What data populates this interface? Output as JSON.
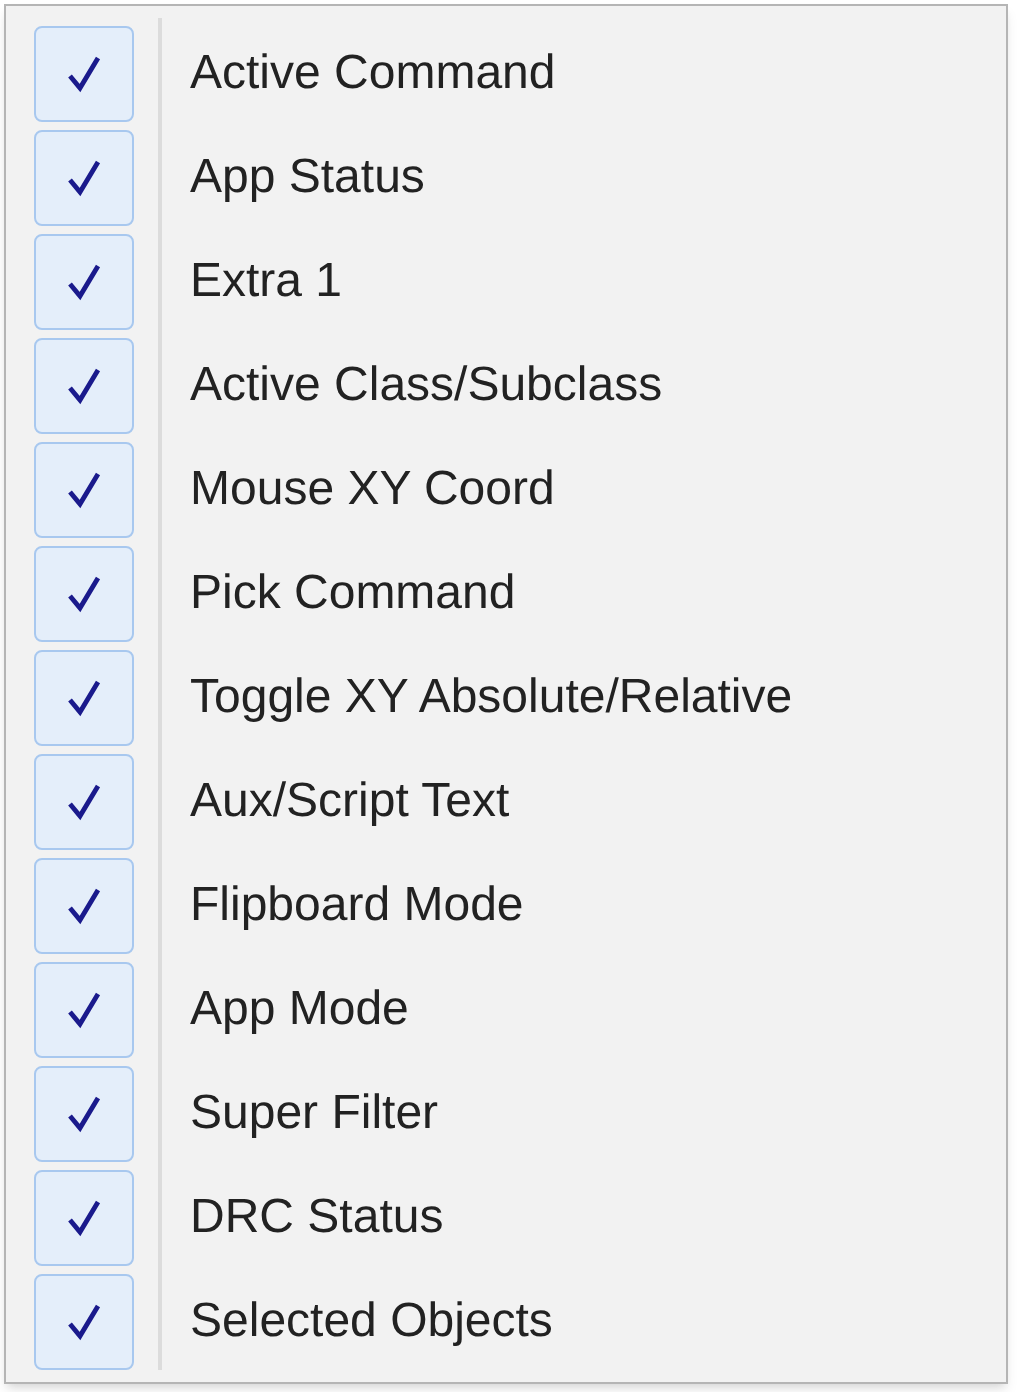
{
  "menu": {
    "items": [
      {
        "label": "Active Command",
        "checked": true
      },
      {
        "label": "App Status",
        "checked": true
      },
      {
        "label": "Extra 1",
        "checked": true
      },
      {
        "label": "Active Class/Subclass",
        "checked": true
      },
      {
        "label": "Mouse XY Coord",
        "checked": true
      },
      {
        "label": "Pick Command",
        "checked": true
      },
      {
        "label": "Toggle XY Absolute/Relative",
        "checked": true
      },
      {
        "label": "Aux/Script Text",
        "checked": true
      },
      {
        "label": "Flipboard Mode",
        "checked": true
      },
      {
        "label": "App Mode",
        "checked": true
      },
      {
        "label": "Super Filter",
        "checked": true
      },
      {
        "label": "DRC Status",
        "checked": true
      },
      {
        "label": "Selected Objects",
        "checked": true
      }
    ]
  }
}
